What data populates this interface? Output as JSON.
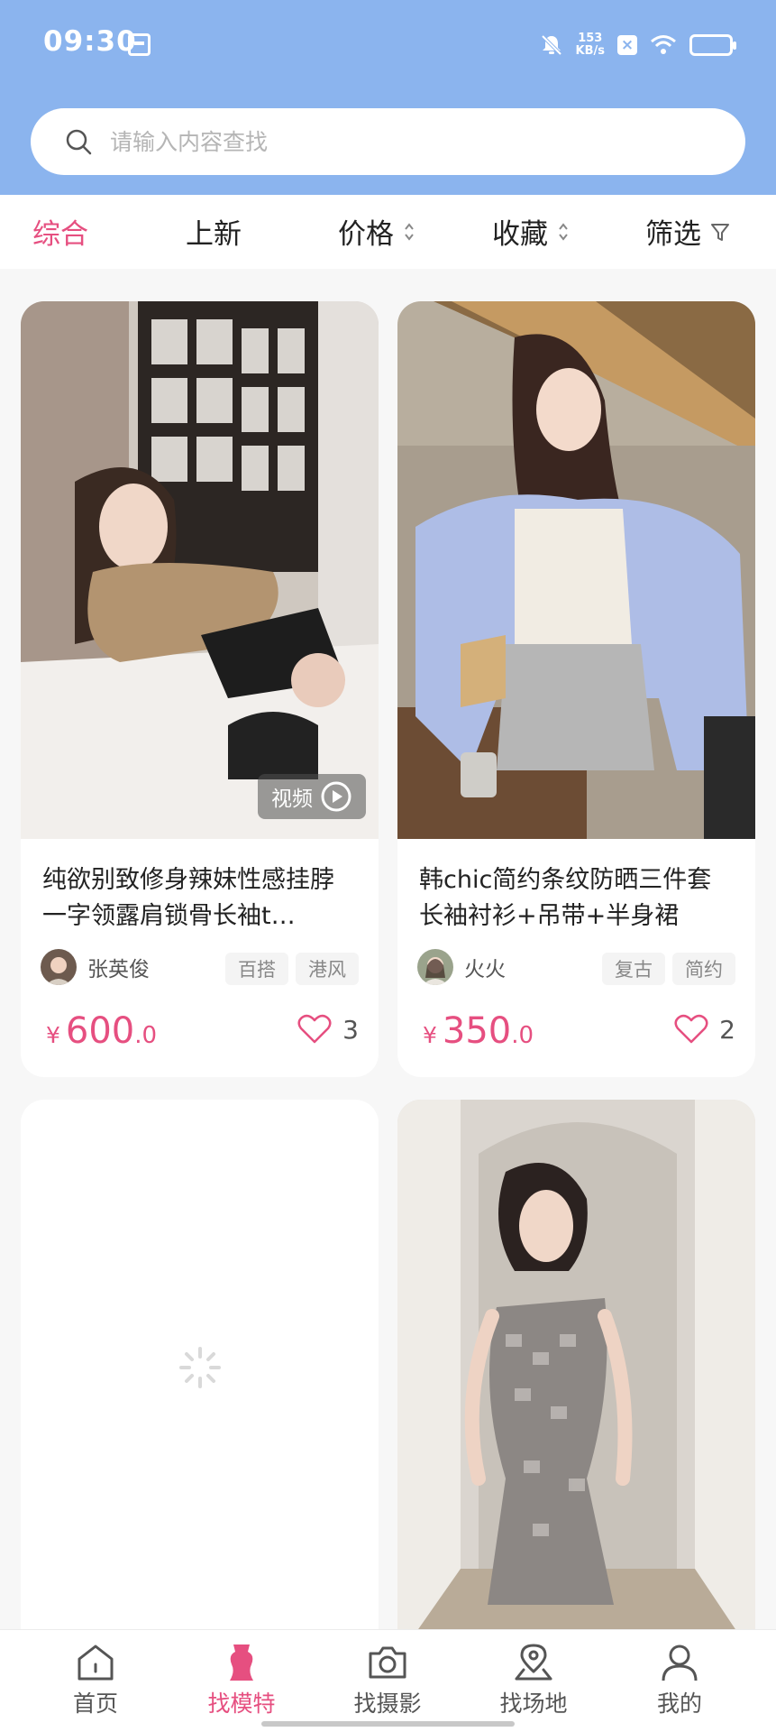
{
  "status_bar": {
    "time": "09:30",
    "net_speed_value": "153",
    "net_speed_unit": "KB/s"
  },
  "search": {
    "placeholder": "请输入内容查找"
  },
  "tabs": [
    {
      "label": "综合",
      "active": true
    },
    {
      "label": "上新"
    },
    {
      "label": "价格"
    },
    {
      "label": "收藏"
    },
    {
      "label": "筛选"
    }
  ],
  "cards": [
    {
      "title": "纯欲别致修身辣妹性感挂脖一字领露肩锁骨长袖t…",
      "author": "张英俊",
      "tags": [
        "百搭",
        "港风"
      ],
      "price_currency": "¥",
      "price_int": "600",
      "price_dec": ".0",
      "likes": "3",
      "video_label": "视频"
    },
    {
      "title": "韩chic简约条纹防晒三件套长袖衬衫+吊带+半身裙",
      "author": "火火",
      "tags": [
        "复古",
        "简约"
      ],
      "price_currency": "¥",
      "price_int": "350",
      "price_dec": ".0",
      "likes": "2"
    }
  ],
  "bottom_nav": [
    {
      "label": "首页",
      "icon": "home-icon"
    },
    {
      "label": "找模特",
      "icon": "dress-form-icon",
      "active": true
    },
    {
      "label": "找摄影",
      "icon": "camera-icon"
    },
    {
      "label": "找场地",
      "icon": "location-icon"
    },
    {
      "label": "我的",
      "icon": "user-icon"
    }
  ],
  "colors": {
    "header": "#8bb4ee",
    "accent": "#e64f80"
  }
}
